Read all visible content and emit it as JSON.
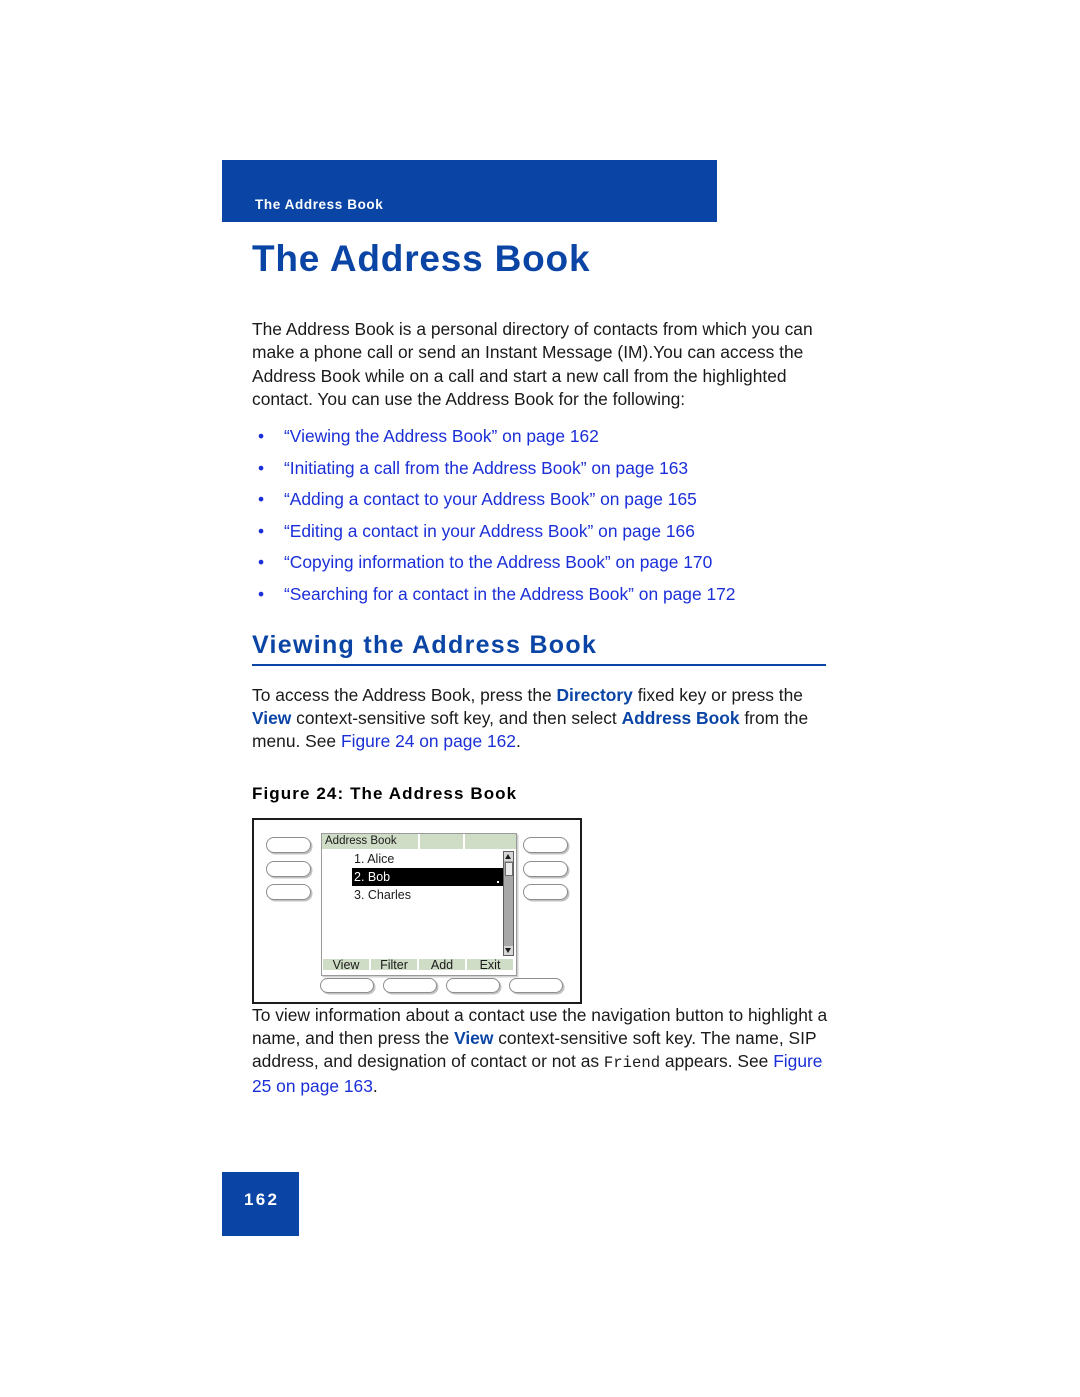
{
  "colors": {
    "brand_blue": "#0a45a6",
    "link_blue": "#1b2fd8",
    "lcd_green": "#cfdcc6",
    "black": "#000000"
  },
  "running_header": {
    "label": "The Address Book"
  },
  "chapter": {
    "title": "The Address Book"
  },
  "intro": {
    "paragraph": "The Address Book is a personal directory of contacts from which you can make a phone call or send an Instant Message (IM).You can access the Address Book while on a call and start a new call from the highlighted contact. You can use the Address Book for the following:"
  },
  "xref_list": {
    "bullet_glyph": "•",
    "items": [
      {
        "text": "“Viewing the Address Book” on page 162"
      },
      {
        "text": "“Initiating a call from the Address Book” on page 163"
      },
      {
        "text": "“Adding a contact to your Address Book” on page 165"
      },
      {
        "text": "“Editing a contact in your Address Book” on page 166"
      },
      {
        "text": "“Copying information to the Address Book” on page 170"
      },
      {
        "text": "“Searching for a contact in the Address Book” on page 172"
      }
    ]
  },
  "section": {
    "heading": "Viewing the Address Book",
    "paragraph": {
      "part1": "To access the Address Book, press the ",
      "key1": "Directory",
      "part2": " fixed key or press the ",
      "key2": "View",
      "part3": " context-sensitive soft key, and then select ",
      "key3": "Address Book",
      "part4": " from the menu. See ",
      "link": "Figure 24 on page 162",
      "part5": "."
    }
  },
  "figure": {
    "caption": "Figure 24:  The Address Book",
    "phone": {
      "lcd_title": "Address Book",
      "list": [
        {
          "text": "1. Alice",
          "selected": false
        },
        {
          "text": "2. Bob",
          "selected": true
        },
        {
          "text": "3. Charles",
          "selected": false
        }
      ],
      "soft_keys": [
        "View",
        "Filter",
        "Add",
        "Exit"
      ],
      "left_keys": [
        "",
        "",
        ""
      ],
      "right_keys": [
        "",
        "",
        ""
      ],
      "bottom_keys": [
        "",
        "",
        "",
        ""
      ],
      "scrollbar": {
        "up_arrow": "scroll-up-arrow",
        "down_arrow": "scroll-down-arrow"
      }
    }
  },
  "closing": {
    "part1": "To view information about a contact use the navigation button to highlight a name, and then press the ",
    "key1": "View",
    "part2": " context-sensitive soft key. The name, SIP address, and designation of contact or not as ",
    "mono1": "Friend",
    "part3": " appears. See ",
    "link": "Figure 25 on page 163",
    "part4": "."
  },
  "footer": {
    "page_number": "162"
  }
}
